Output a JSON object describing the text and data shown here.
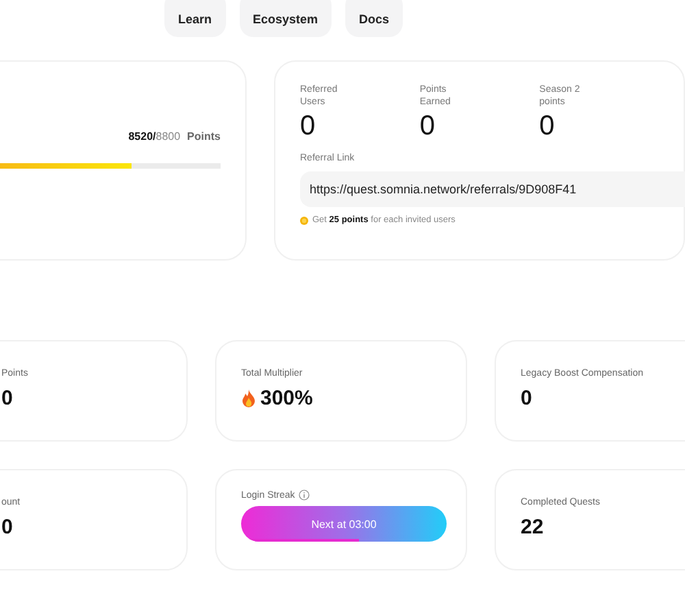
{
  "nav": [
    {
      "label": "Learn"
    },
    {
      "label": "Ecosystem"
    },
    {
      "label": "Docs"
    }
  ],
  "progress": {
    "current": "8520/",
    "total": "8800",
    "unit": "Points",
    "level": 0.81
  },
  "referral": {
    "stats": [
      {
        "label": "Referred Users",
        "value": "0"
      },
      {
        "label": "Points Earned",
        "value": "0"
      },
      {
        "label": "Season 2 points",
        "value": "0"
      }
    ],
    "link_label": "Referral Link",
    "link": "https://quest.somnia.network/referrals/9D908F41",
    "note": "Get **25 points** for each invited users"
  },
  "tiles": [
    {
      "kind": "stat",
      "label": "Points",
      "value": "0"
    },
    {
      "kind": "multiplier",
      "label": "Total Multiplier",
      "value": "300%"
    },
    {
      "kind": "stat",
      "label": "Legacy Boost Compensation",
      "value": "0"
    },
    {
      "kind": "stat",
      "label": "ount",
      "value": "0"
    },
    {
      "kind": "streak",
      "label": "Login Streak",
      "button": "Next at 03:00",
      "level": 0.57
    },
    {
      "kind": "stat",
      "label": "Completed Quests",
      "value": "22"
    }
  ]
}
